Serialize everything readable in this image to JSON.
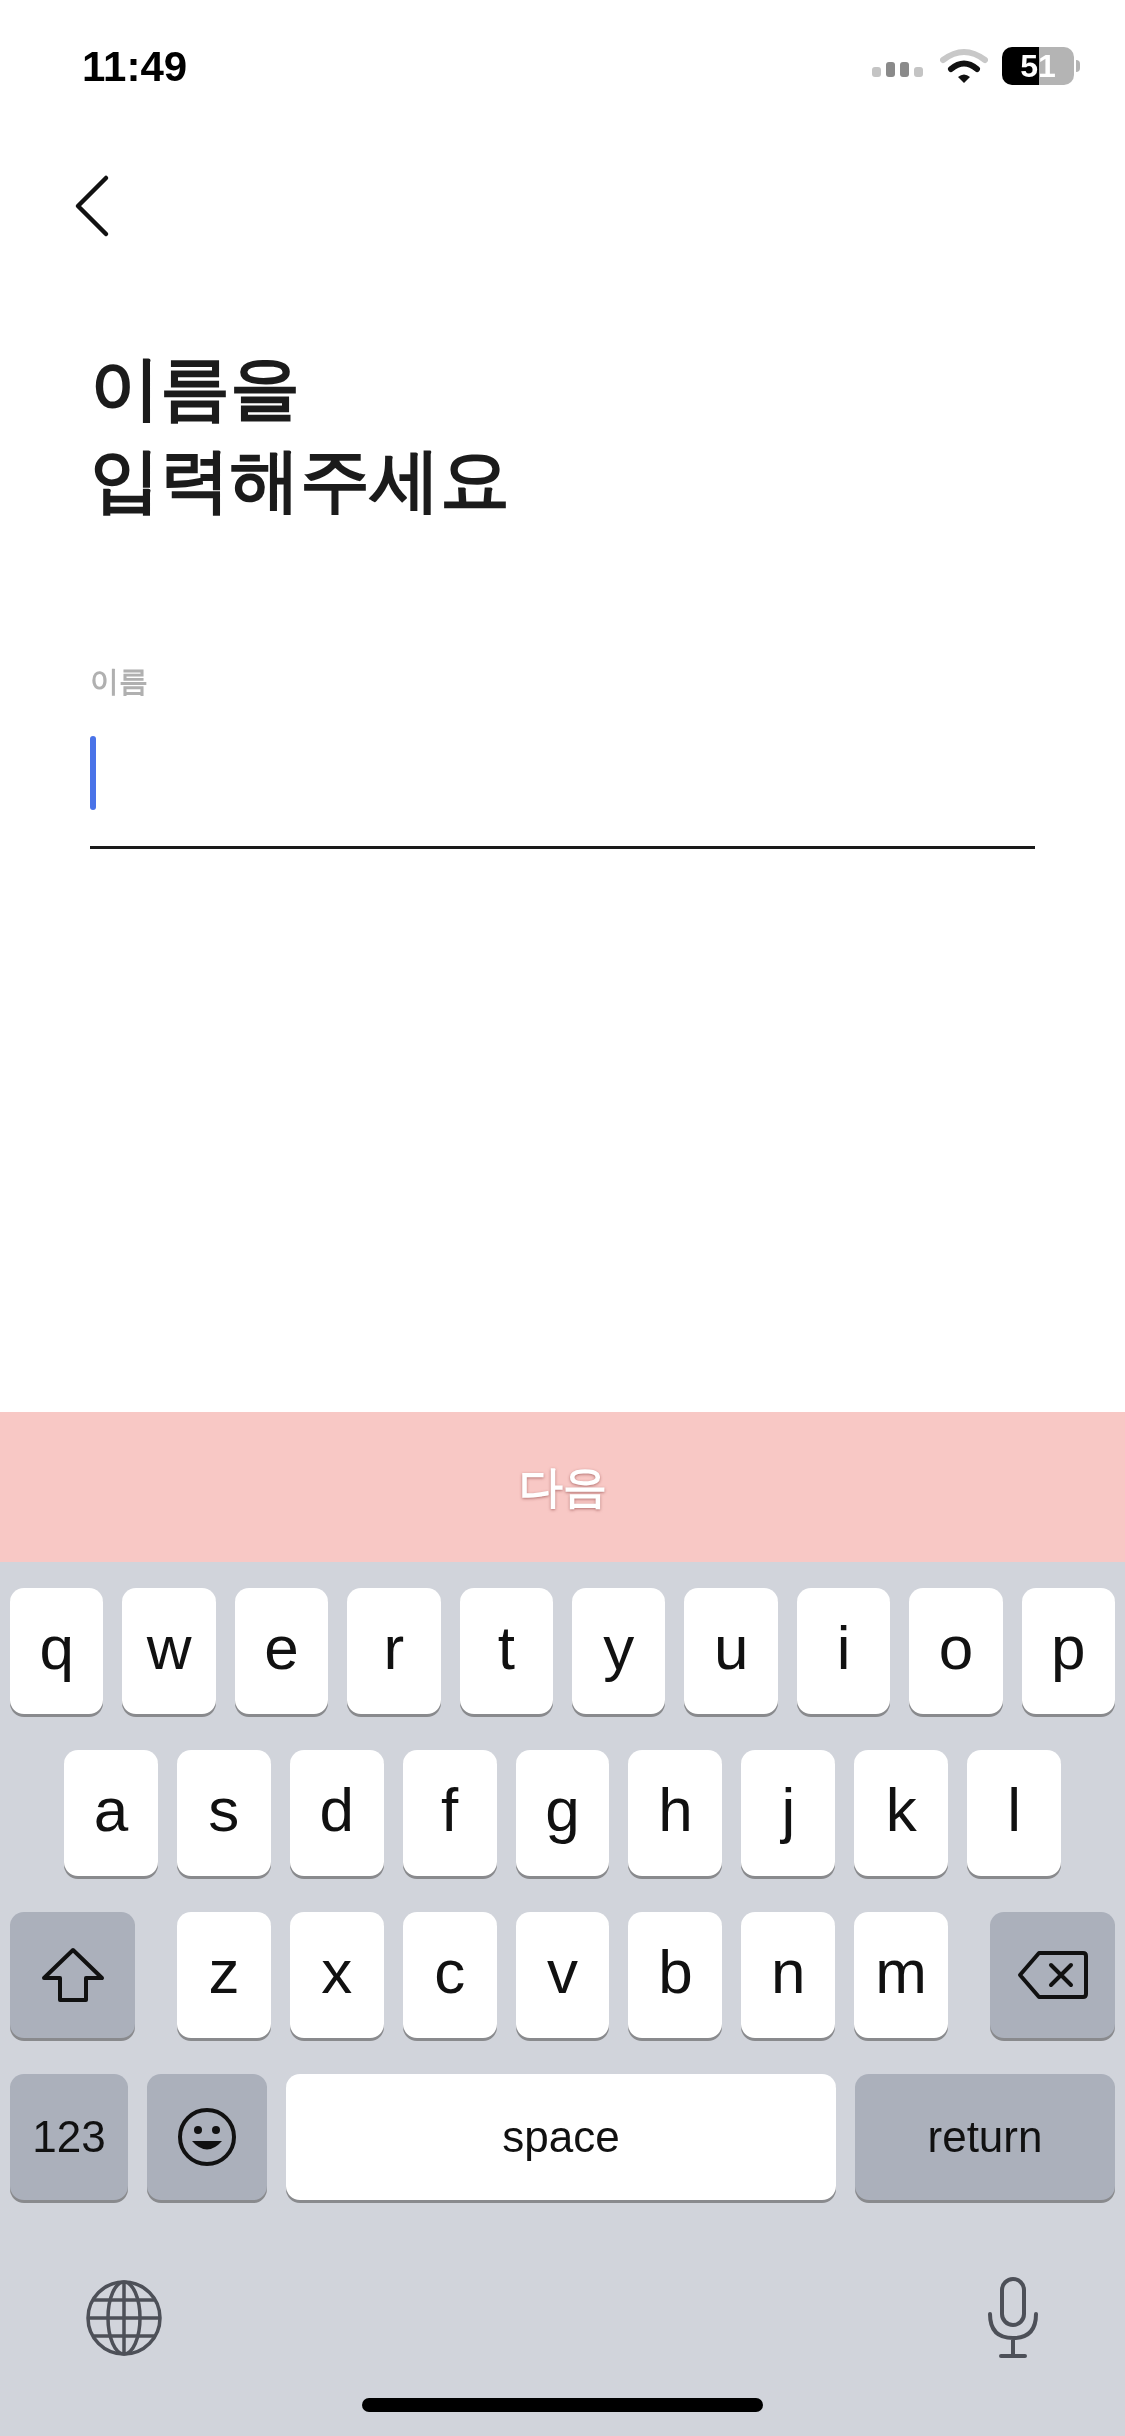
{
  "status_bar": {
    "time": "11:49",
    "battery": "51"
  },
  "title_lines": [
    "이름을",
    "입력해주세요"
  ],
  "field": {
    "label": "이름",
    "focused": true
  },
  "next_button": {
    "label": "다음",
    "disabled": true
  },
  "keyboard": {
    "rows": [
      {
        "keys": [
          {
            "kind": "letter",
            "label": "q"
          },
          {
            "kind": "letter",
            "label": "w"
          },
          {
            "kind": "letter",
            "label": "e"
          },
          {
            "kind": "letter",
            "label": "r"
          },
          {
            "kind": "letter",
            "label": "t"
          },
          {
            "kind": "letter",
            "label": "y"
          },
          {
            "kind": "letter",
            "label": "u"
          },
          {
            "kind": "letter",
            "label": "i"
          },
          {
            "kind": "letter",
            "label": "o"
          },
          {
            "kind": "letter",
            "label": "p"
          }
        ]
      },
      {
        "keys": [
          {
            "kind": "letter",
            "label": "a"
          },
          {
            "kind": "letter",
            "label": "s"
          },
          {
            "kind": "letter",
            "label": "d"
          },
          {
            "kind": "letter",
            "label": "f"
          },
          {
            "kind": "letter",
            "label": "g"
          },
          {
            "kind": "letter",
            "label": "h"
          },
          {
            "kind": "letter",
            "label": "j"
          },
          {
            "kind": "letter",
            "label": "k"
          },
          {
            "kind": "letter",
            "label": "l"
          }
        ]
      },
      {
        "keys": [
          {
            "kind": "shift"
          },
          {
            "kind": "letter",
            "label": "z"
          },
          {
            "kind": "letter",
            "label": "x"
          },
          {
            "kind": "letter",
            "label": "c"
          },
          {
            "kind": "letter",
            "label": "v"
          },
          {
            "kind": "letter",
            "label": "b"
          },
          {
            "kind": "letter",
            "label": "n"
          },
          {
            "kind": "letter",
            "label": "m"
          },
          {
            "kind": "delete"
          }
        ]
      },
      {
        "keys": [
          {
            "kind": "numbers",
            "label": "123"
          },
          {
            "kind": "emoji"
          },
          {
            "kind": "space",
            "label": "space"
          },
          {
            "kind": "return",
            "label": "return"
          }
        ]
      }
    ]
  }
}
